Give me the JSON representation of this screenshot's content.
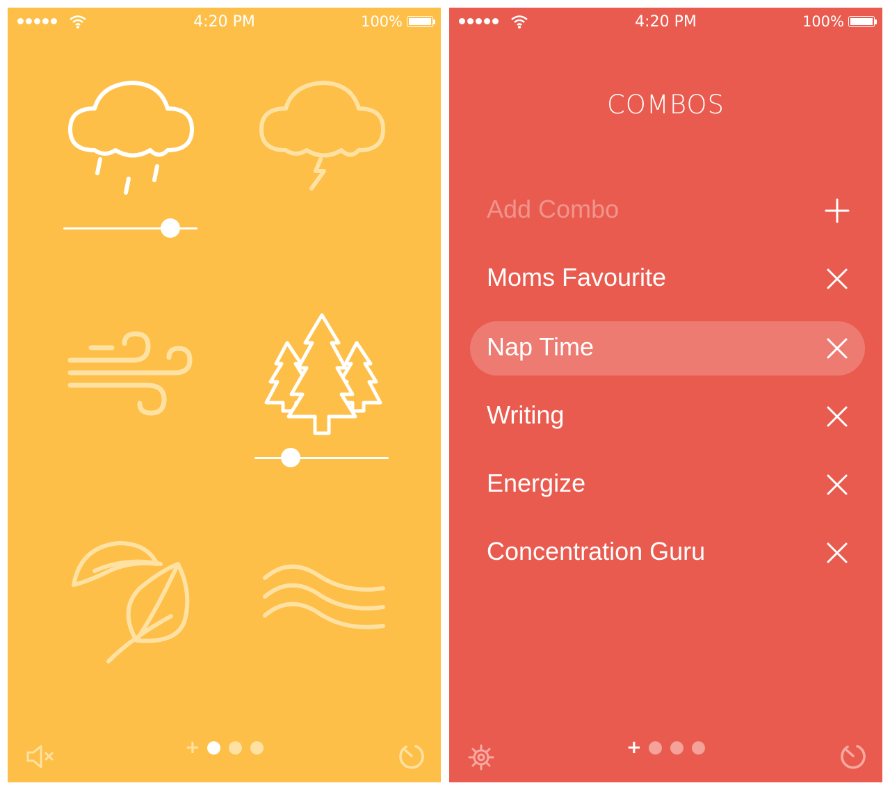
{
  "status_bar": {
    "time": "4:20 PM",
    "battery": "100%"
  },
  "colors": {
    "left_bg": "#fdbf47",
    "right_bg": "#ea5b4f"
  },
  "left_screen": {
    "sounds": [
      {
        "name": "rain",
        "icon": "rain-cloud-icon",
        "active": true,
        "volume": 0.8
      },
      {
        "name": "thunder",
        "icon": "thunder-cloud-icon",
        "active": false
      },
      {
        "name": "wind",
        "icon": "wind-icon",
        "active": false
      },
      {
        "name": "forest",
        "icon": "forest-icon",
        "active": true,
        "volume": 0.27
      },
      {
        "name": "leaves",
        "icon": "leaves-icon",
        "active": false
      },
      {
        "name": "waves",
        "icon": "waves-icon",
        "active": false
      }
    ],
    "bottom": {
      "left_icon": "mute-icon",
      "right_icon": "timer-icon",
      "active_page": 1
    }
  },
  "right_screen": {
    "title": "COMBOS",
    "add_label": "Add Combo",
    "combos": [
      {
        "label": "Moms Favourite",
        "selected": false
      },
      {
        "label": "Nap Time",
        "selected": true
      },
      {
        "label": "Writing",
        "selected": false
      },
      {
        "label": "Energize",
        "selected": false
      },
      {
        "label": "Concentration Guru",
        "selected": false
      }
    ],
    "bottom": {
      "left_icon": "gear-icon",
      "right_icon": "timer-icon",
      "active_page": 0
    }
  }
}
